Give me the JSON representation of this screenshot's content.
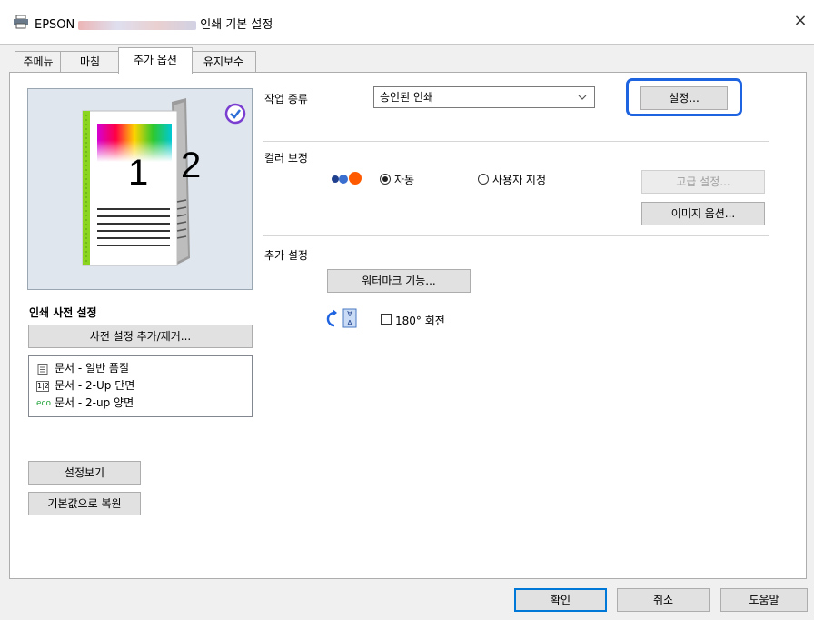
{
  "window": {
    "title_prefix": "EPSON",
    "title_suffix": "인쇄 기본 설정",
    "close_glyph": "×"
  },
  "tabs": [
    {
      "label": "주메뉴"
    },
    {
      "label": "마침"
    },
    {
      "label": "추가 옵션",
      "selected": true
    },
    {
      "label": "유지보수"
    }
  ],
  "preview": {
    "page1_number": "1",
    "page2_number": "2"
  },
  "presets": {
    "heading": "인쇄 사전 설정",
    "add_remove_label": "사전 설정 추가/제거...",
    "items": [
      {
        "icon": "document-icon",
        "label": "문서 - 일반 품질"
      },
      {
        "icon": "two-up-icon",
        "label": "문서 - 2-Up 단면"
      },
      {
        "icon": "eco-icon",
        "label": "문서 - 2-up 양면",
        "icon_text": "eco"
      }
    ],
    "two_up_text": "1|2"
  },
  "left_buttons": {
    "show_settings": "설정보기",
    "restore_defaults": "기본값으로 복원"
  },
  "job_type": {
    "label": "작업 종류",
    "selected": "승인된 인쇄",
    "settings_button": "설정..."
  },
  "color_correction": {
    "label": "컬러 보정",
    "auto_label": "자동",
    "custom_label": "사용자 지정",
    "selected": "auto",
    "advanced_button": "고급 설정...",
    "image_options_button": "이미지 옵션..."
  },
  "extra_settings": {
    "label": "추가 설정",
    "watermark_button": "워터마크 기능...",
    "rotate_label": "180° 회전",
    "rotate_checked": false
  },
  "footer": {
    "ok": "확인",
    "cancel": "취소",
    "help": "도움말"
  },
  "colors": {
    "accent_highlight": "#1e63e0",
    "ok_border": "#0078d7",
    "color_dots": [
      "#1f3f8f",
      "#3a6fd0",
      "#ff5a00"
    ]
  }
}
